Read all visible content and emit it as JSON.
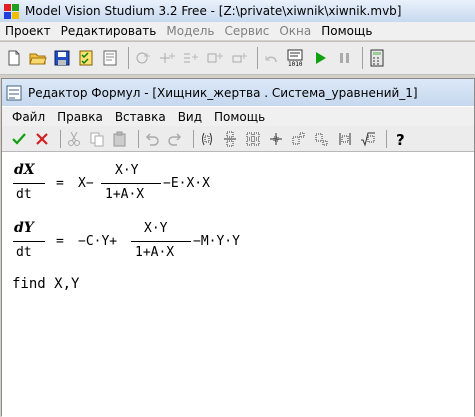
{
  "app": {
    "title": "Model Vision Studium 3.2 Free - [Z:\\private\\xiwnik\\xiwnik.mvb]"
  },
  "menu": {
    "items": [
      {
        "label": "Проект",
        "dim": false
      },
      {
        "label": "Редактировать",
        "dim": false
      },
      {
        "label": "Модель",
        "dim": true
      },
      {
        "label": "Сервис",
        "dim": true
      },
      {
        "label": "Окна",
        "dim": true
      },
      {
        "label": "Помощь",
        "dim": false
      }
    ]
  },
  "editor_window": {
    "title": "Редактор Формул - [Хищник_жертва . Система_уравнений_1]",
    "menu": [
      "Файл",
      "Правка",
      "Вставка",
      "Вид",
      "Помощь"
    ]
  },
  "equations": {
    "eq1": {
      "lhs_num": "dX",
      "lhs_den": "dt",
      "eq_sign": "=",
      "term1": "X−",
      "frac_num": "X·Y",
      "frac_den": "1+A·X",
      "tail": "−E·X·X"
    },
    "eq2": {
      "lhs_num": "dY",
      "lhs_den": "dt",
      "eq_sign": "=",
      "term1": "−C·Y+",
      "frac_num": "X·Y",
      "frac_den": "1+A·X",
      "tail": "−M·Y·Y"
    },
    "find": "find X,Y"
  }
}
